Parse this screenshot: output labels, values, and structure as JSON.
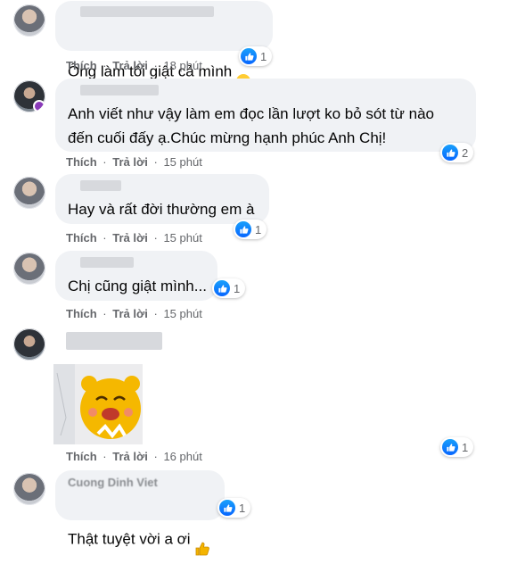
{
  "actions": {
    "like": "Thích",
    "reply": "Trả lời",
    "dot": "·"
  },
  "comments": [
    {
      "text": "Ông làm tôi giật cả mình",
      "emoji": "disappointed-emoji",
      "time": "18 phút",
      "likes": "1"
    },
    {
      "text": "Anh viết như vậy làm em đọc lần lượt ko bỏ sót từ nào\nđến cuối đấy ạ.Chúc mừng hạnh phúc Anh Chị!",
      "time": "15 phút",
      "likes": "2"
    },
    {
      "text": "Hay và rất đời thường em à",
      "time": "15 phút",
      "likes": "1"
    },
    {
      "text": "Chị cũng giật mình...",
      "time": "15 phút",
      "likes": "1"
    },
    {
      "sticker": "laughing-bear-sticker",
      "time": "16 phút",
      "likes": "1"
    },
    {
      "author": "Cuong Dinh Viet",
      "text": "Thật tuyệt vời a ơi",
      "emoji": "thumbs-up-emoji",
      "likes": "1"
    }
  ],
  "colors": {
    "like_blue": "#0866ff",
    "bubble": "#f0f2f5",
    "meta": "#65676b"
  }
}
